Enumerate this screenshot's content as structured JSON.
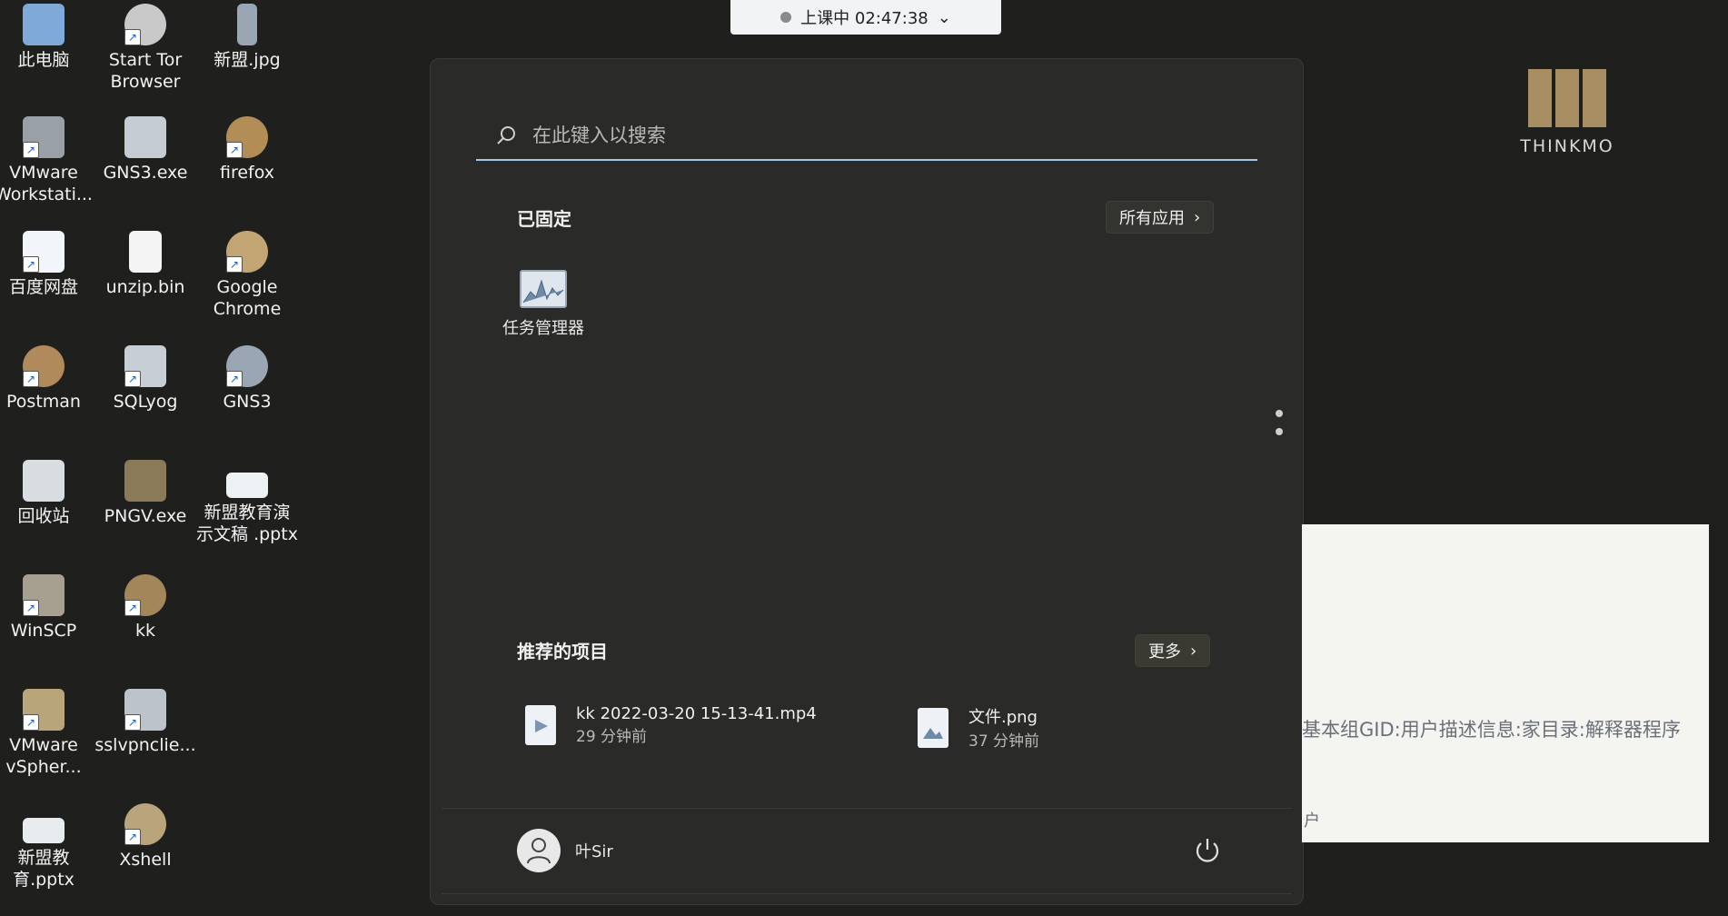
{
  "desktop": {
    "icons": [
      {
        "label": "此电脑",
        "icon": "computer-icon"
      },
      {
        "label": "Start Tor Browser",
        "icon": "tor-browser-icon"
      },
      {
        "label": "新盟.jpg",
        "icon": "image-file-icon"
      },
      {
        "label": "VMware Workstati...",
        "icon": "vmware-icon"
      },
      {
        "label": "GNS3.exe",
        "icon": "gns3-installer-icon"
      },
      {
        "label": "firefox",
        "icon": "firefox-icon"
      },
      {
        "label": "百度网盘",
        "icon": "baidu-netdisk-icon"
      },
      {
        "label": "unzip.bin",
        "icon": "file-icon"
      },
      {
        "label": "Google Chrome",
        "icon": "chrome-icon"
      },
      {
        "label": "Postman",
        "icon": "postman-icon"
      },
      {
        "label": "SQLyog",
        "icon": "sqlyog-icon"
      },
      {
        "label": "GNS3",
        "icon": "gns3-icon"
      },
      {
        "label": "回收站",
        "icon": "recycle-bin-icon"
      },
      {
        "label": "PNGV.exe",
        "icon": "pngv-icon"
      },
      {
        "label": "新盟教育演示文稿 .pptx",
        "icon": "pptx-icon"
      },
      {
        "label": "WinSCP",
        "icon": "winscp-icon"
      },
      {
        "label": "kk",
        "icon": "kk-icon"
      },
      {
        "label": "VMware vSpher...",
        "icon": "vsphere-icon"
      },
      {
        "label": "sslvpnclie...",
        "icon": "sslvpn-icon"
      },
      {
        "label": "新盟教育.pptx",
        "icon": "pptx-icon"
      },
      {
        "label": "Xshell",
        "icon": "xshell-icon"
      }
    ]
  },
  "session": {
    "status": "上课中 02:47:38",
    "chevron": "chevron-down-icon"
  },
  "start_menu": {
    "search_placeholder": "在此键入以搜索",
    "pinned_title": "已固定",
    "all_apps_label": "所有应用",
    "pinned_apps": [
      {
        "label": "任务管理器",
        "icon": "task-manager-icon"
      }
    ],
    "recommended_title": "推荐的项目",
    "more_label": "更多",
    "recommended": [
      {
        "name": "kk 2022-03-20 15-13-41.mp4",
        "time": "29 分钟前",
        "icon": "video-file-icon"
      },
      {
        "name": "文件.png",
        "time": "37 分钟前",
        "icon": "image-file-icon"
      }
    ],
    "user_name": "叶Sir"
  },
  "logo": {
    "brand": "THINKMO"
  },
  "doc_panel": {
    "line1": "基本组GID:用户描述信息:家目录:解释器程序",
    "line2": "户"
  },
  "colors": {
    "accent": "#a8c7e8",
    "desktop_bg": "#1f201e",
    "menu_bg": "#2a2b28",
    "logo_gold": "#a78e63"
  }
}
